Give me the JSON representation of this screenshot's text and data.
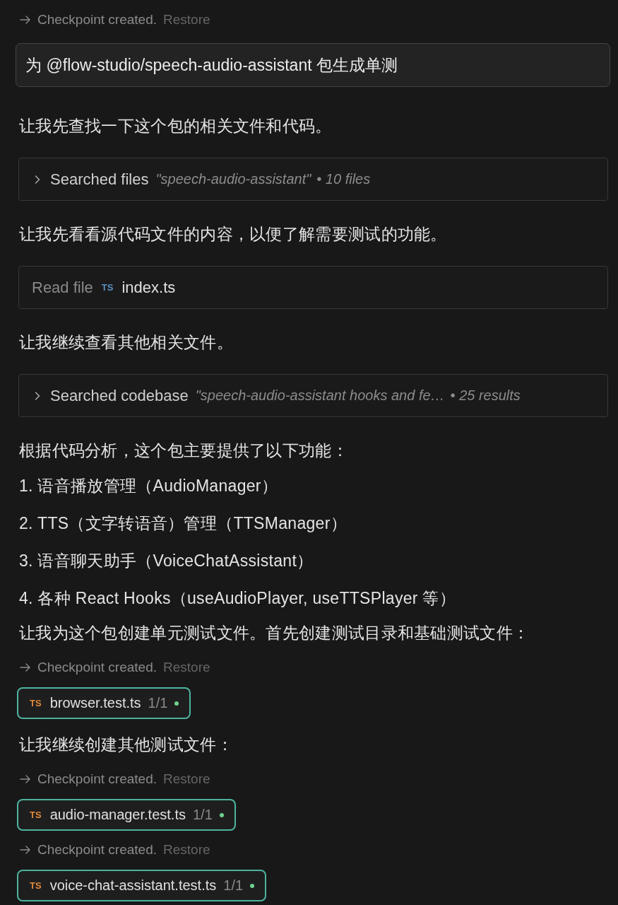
{
  "feed": [
    {
      "kind": "checkpoint",
      "text": "Checkpoint created.",
      "action": "Restore"
    },
    {
      "kind": "user_message",
      "text": "为 @flow-studio/speech-audio-assistant 包生成单测"
    },
    {
      "kind": "paragraph",
      "text": "让我先查找一下这个包的相关文件和代码。"
    },
    {
      "kind": "search",
      "label": "Searched files",
      "query": "\"speech-audio-assistant\"",
      "summary": "• 10 files",
      "expanded": false
    },
    {
      "kind": "paragraph",
      "text": "让我先看看源代码文件的内容，以便了解需要测试的功能。"
    },
    {
      "kind": "read_file",
      "label": "Read file",
      "file_type": "TS",
      "file": "index.ts"
    },
    {
      "kind": "paragraph",
      "text": "让我继续查看其他相关文件。"
    },
    {
      "kind": "search",
      "label": "Searched codebase",
      "query": "\"speech-audio-assistant hooks and fe…",
      "summary": "• 25 results",
      "expanded": false
    },
    {
      "kind": "paragraph",
      "text": "根据代码分析，这个包主要提供了以下功能："
    },
    {
      "kind": "list_item",
      "text": "1. 语音播放管理（AudioManager）"
    },
    {
      "kind": "list_item",
      "text": "2. TTS（文字转语音）管理（TTSManager）"
    },
    {
      "kind": "list_item",
      "text": "3. 语音聊天助手（VoiceChatAssistant）"
    },
    {
      "kind": "list_item",
      "text": "4. 各种 React Hooks（useAudioPlayer, useTTSPlayer 等）"
    },
    {
      "kind": "paragraph",
      "text": "让我为这个包创建单元测试文件。首先创建测试目录和基础测试文件："
    },
    {
      "kind": "checkpoint",
      "text": "Checkpoint created.",
      "action": "Restore"
    },
    {
      "kind": "file_edit",
      "file_type": "TS",
      "file": "browser.test.ts",
      "count": "1/1"
    },
    {
      "kind": "paragraph",
      "text": "让我继续创建其他测试文件："
    },
    {
      "kind": "checkpoint",
      "text": "Checkpoint created.",
      "action": "Restore"
    },
    {
      "kind": "file_edit",
      "file_type": "TS",
      "file": "audio-manager.test.ts",
      "count": "1/1"
    },
    {
      "kind": "checkpoint",
      "text": "Checkpoint created.",
      "action": "Restore"
    },
    {
      "kind": "file_edit",
      "file_type": "TS",
      "file": "voice-chat-assistant.test.ts",
      "count": "1/1"
    }
  ]
}
